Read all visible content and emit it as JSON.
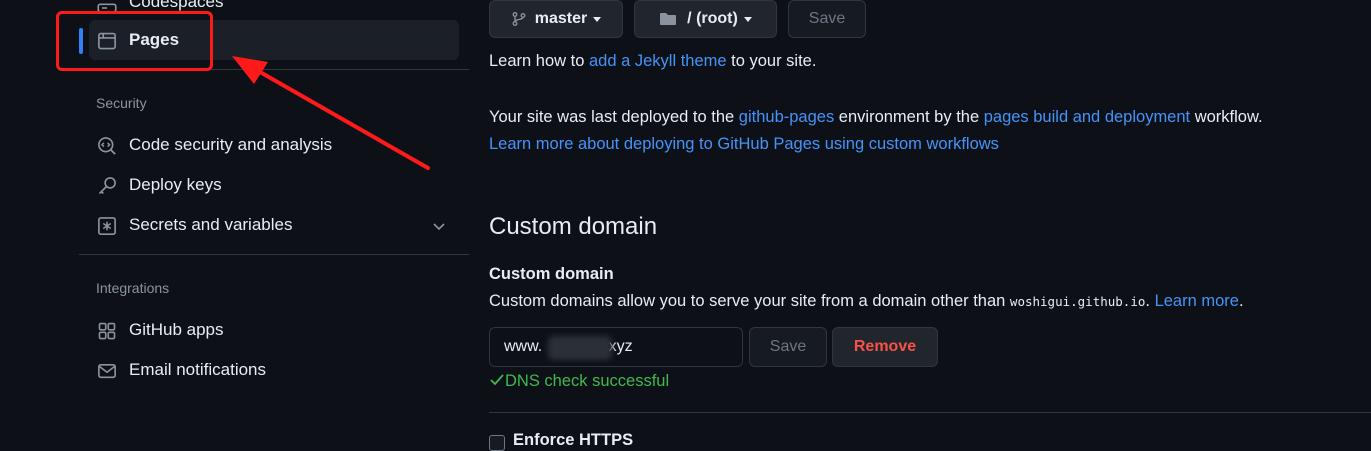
{
  "sidebar": {
    "codespaces_label": "Codespaces",
    "pages_label": "Pages",
    "security_heading": "Security",
    "security_items": [
      {
        "label": "Code security and analysis",
        "icon": "codescan-icon"
      },
      {
        "label": "Deploy keys",
        "icon": "key-icon"
      },
      {
        "label": "Secrets and variables",
        "icon": "asterisk-icon"
      }
    ],
    "integrations_heading": "Integrations",
    "integration_items": [
      {
        "label": "GitHub apps",
        "icon": "apps-icon"
      },
      {
        "label": "Email notifications",
        "icon": "mail-icon"
      }
    ]
  },
  "branch": {
    "branch_label": "master",
    "folder_label": "/ (root)",
    "save_label": "Save"
  },
  "theme_text": {
    "prefix": "Learn how to ",
    "link": "add a Jekyll theme",
    "suffix": " to your site."
  },
  "deploy_text": {
    "prefix": "Your site was last deployed to the ",
    "env_link": "github-pages",
    "middle": " environment by the ",
    "workflow_link": "pages build and deployment",
    "suffix": " workflow.",
    "learn_link": "Learn more about deploying to GitHub Pages using custom workflows"
  },
  "custom_domain": {
    "heading": "Custom domain",
    "label": "Custom domain",
    "desc_prefix": "Custom domains allow you to serve your site from a domain other than ",
    "desc_code": "woshigui.github.io",
    "desc_dot": ".",
    "learn_more": "Learn more",
    "desc_end": ".",
    "input_prefix": "www.",
    "input_suffix": ".xyz",
    "save_label": "Save",
    "remove_label": "Remove",
    "dns_status": "DNS check successful"
  },
  "enforce_https_label": "Enforce HTTPS",
  "colors": {
    "background": "#0d1117",
    "link": "#4493f8",
    "danger": "#f85149",
    "success": "#3fb950",
    "annotation": "#ff1a1a"
  }
}
